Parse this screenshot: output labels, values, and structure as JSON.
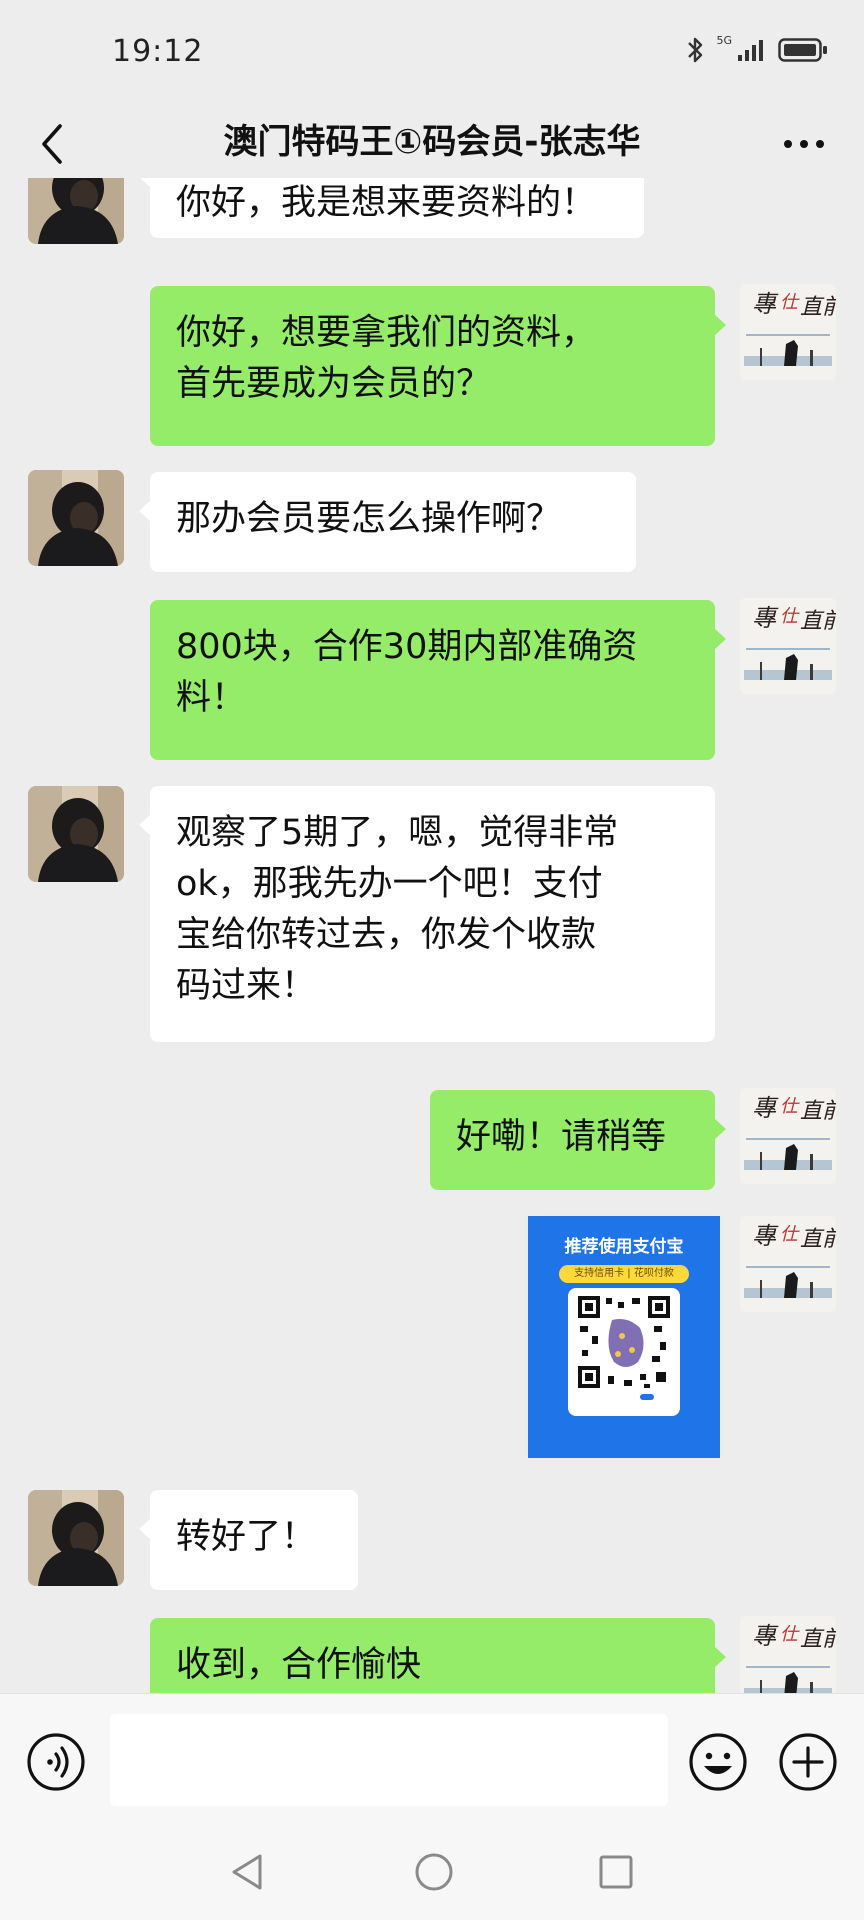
{
  "status_bar": {
    "time": "19:12",
    "network": "5G",
    "icons": [
      "bluetooth-icon",
      "signal-icon",
      "battery-icon"
    ]
  },
  "header": {
    "title": "澳门特码王①码会员-张志华",
    "back_icon": "chevron-left-icon",
    "more_icon": "ellipsis-icon"
  },
  "messages": [
    {
      "side": "left",
      "text": "你好，我是想来要资料的！"
    },
    {
      "side": "right",
      "text": "你好，想要拿我们的资料，\n首先要成为会员的？"
    },
    {
      "side": "left",
      "text": "那办会员要怎么操作啊？"
    },
    {
      "side": "right",
      "text": "800块，合作30期内部准确资\n料！"
    },
    {
      "side": "left",
      "text": "观察了5期了，嗯，觉得非常\nok，那我先办一个吧！支付\n宝给你转过去，你发个收款\n码过来！"
    },
    {
      "side": "right",
      "text": "好嘞！请稍等"
    },
    {
      "side": "right",
      "type": "image",
      "qr_title": "推荐使用支付宝",
      "qr_subtitle": "支持信用卡 | 花呗付款"
    },
    {
      "side": "left",
      "text": "转好了！"
    },
    {
      "side": "right",
      "text": "收到，合作愉快"
    }
  ],
  "input_bar": {
    "placeholder": "",
    "voice_icon": "voice-icon",
    "emoji_icon": "emoji-icon",
    "plus_icon": "plus-icon"
  },
  "nav_bar": {
    "icons": [
      "nav-back-icon",
      "nav-home-icon",
      "nav-recent-icon"
    ]
  },
  "colors": {
    "background": "#ededed",
    "bubble_sent": "#95ec69",
    "bubble_received": "#ffffff",
    "qr_card": "#1f74e8"
  }
}
